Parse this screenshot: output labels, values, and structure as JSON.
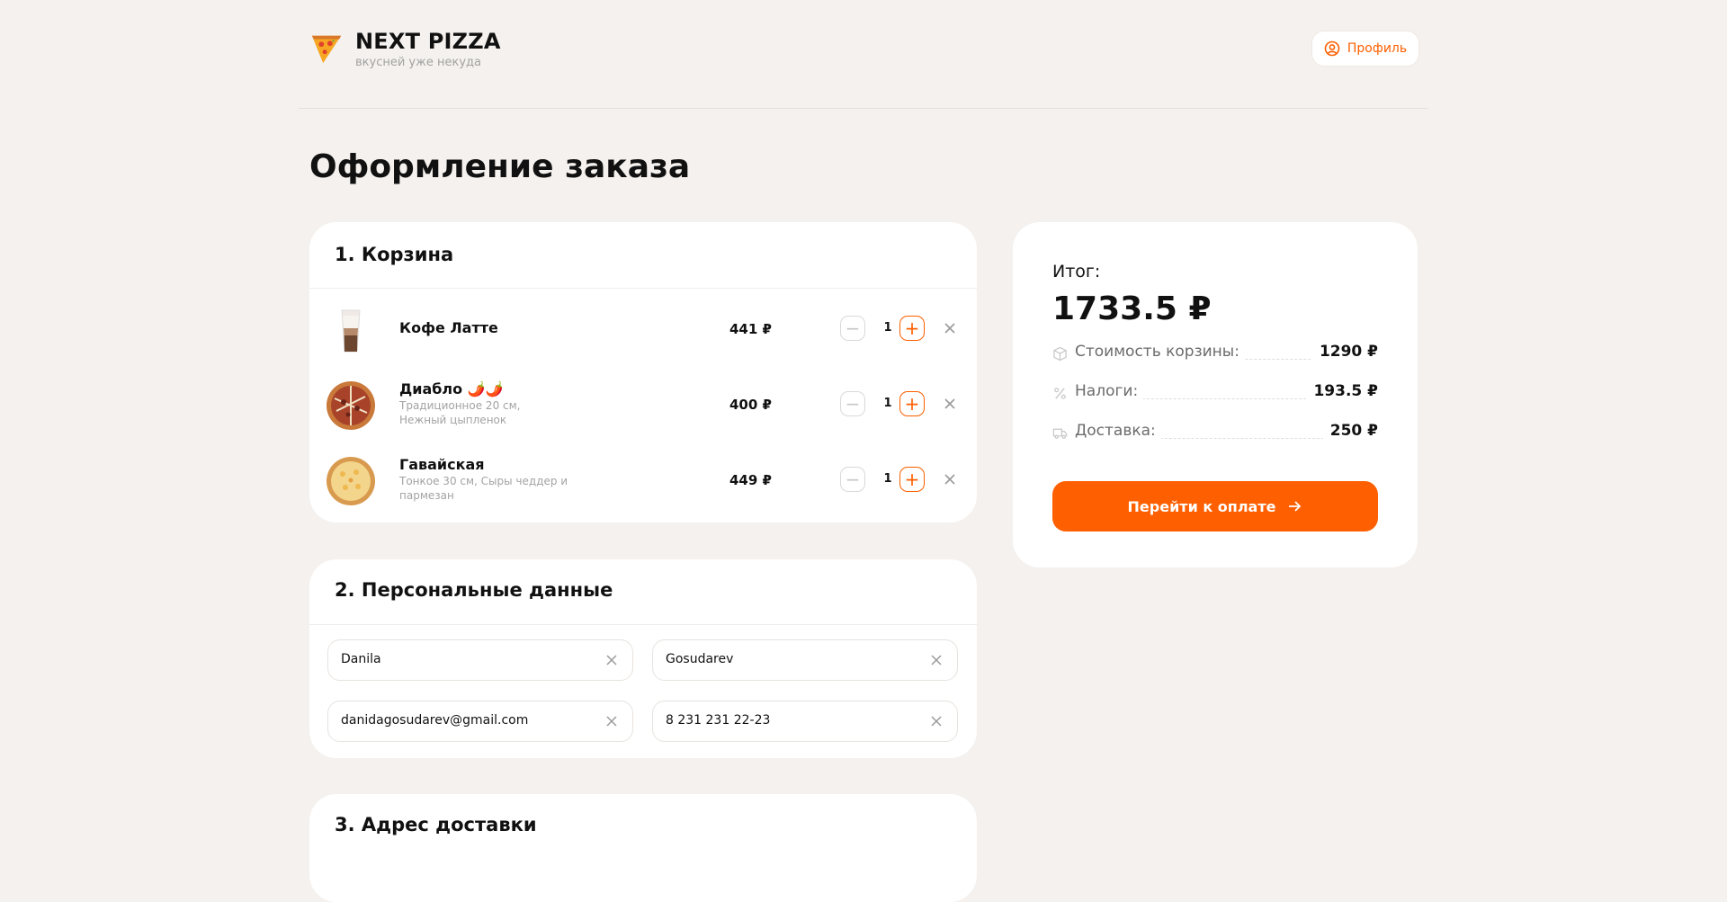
{
  "header": {
    "brand_title": "NEXT PIZZA",
    "brand_subtitle": "вкусней уже некуда",
    "profile_label": "Профиль"
  },
  "page_title": "Оформление заказа",
  "cart": {
    "title": "1. Корзина",
    "items": [
      {
        "name": "Кофе Латте",
        "desc": "",
        "price": "441 ₽",
        "qty": "1"
      },
      {
        "name": "Диабло 🌶️🌶️",
        "desc": "Традиционное 20 см, Нежный цыпленок",
        "price": "400 ₽",
        "qty": "1"
      },
      {
        "name": "Гавайская",
        "desc": "Тонкое 30 см, Сыры чеддер и пармезан",
        "price": "449 ₽",
        "qty": "1"
      }
    ]
  },
  "personal": {
    "title": "2. Персональные данные",
    "first_name": "Danila",
    "last_name": "Gosudarev",
    "email": "danidagosudarev@gmail.com",
    "phone": "8 231 231 22-23"
  },
  "address": {
    "title": "3. Адрес доставки"
  },
  "summary": {
    "label": "Итог:",
    "total": "1733.5 ₽",
    "rows": [
      {
        "label": "Стоимость корзины:",
        "value": "1290 ₽",
        "icon": "package-icon"
      },
      {
        "label": "Налоги:",
        "value": "193.5 ₽",
        "icon": "percent-icon"
      },
      {
        "label": "Доставка:",
        "value": "250 ₽",
        "icon": "truck-icon"
      }
    ],
    "pay_label": "Перейти к оплате"
  },
  "colors": {
    "accent": "#FE5F00",
    "background": "#F4F1EE",
    "card": "#FFFFFF"
  }
}
